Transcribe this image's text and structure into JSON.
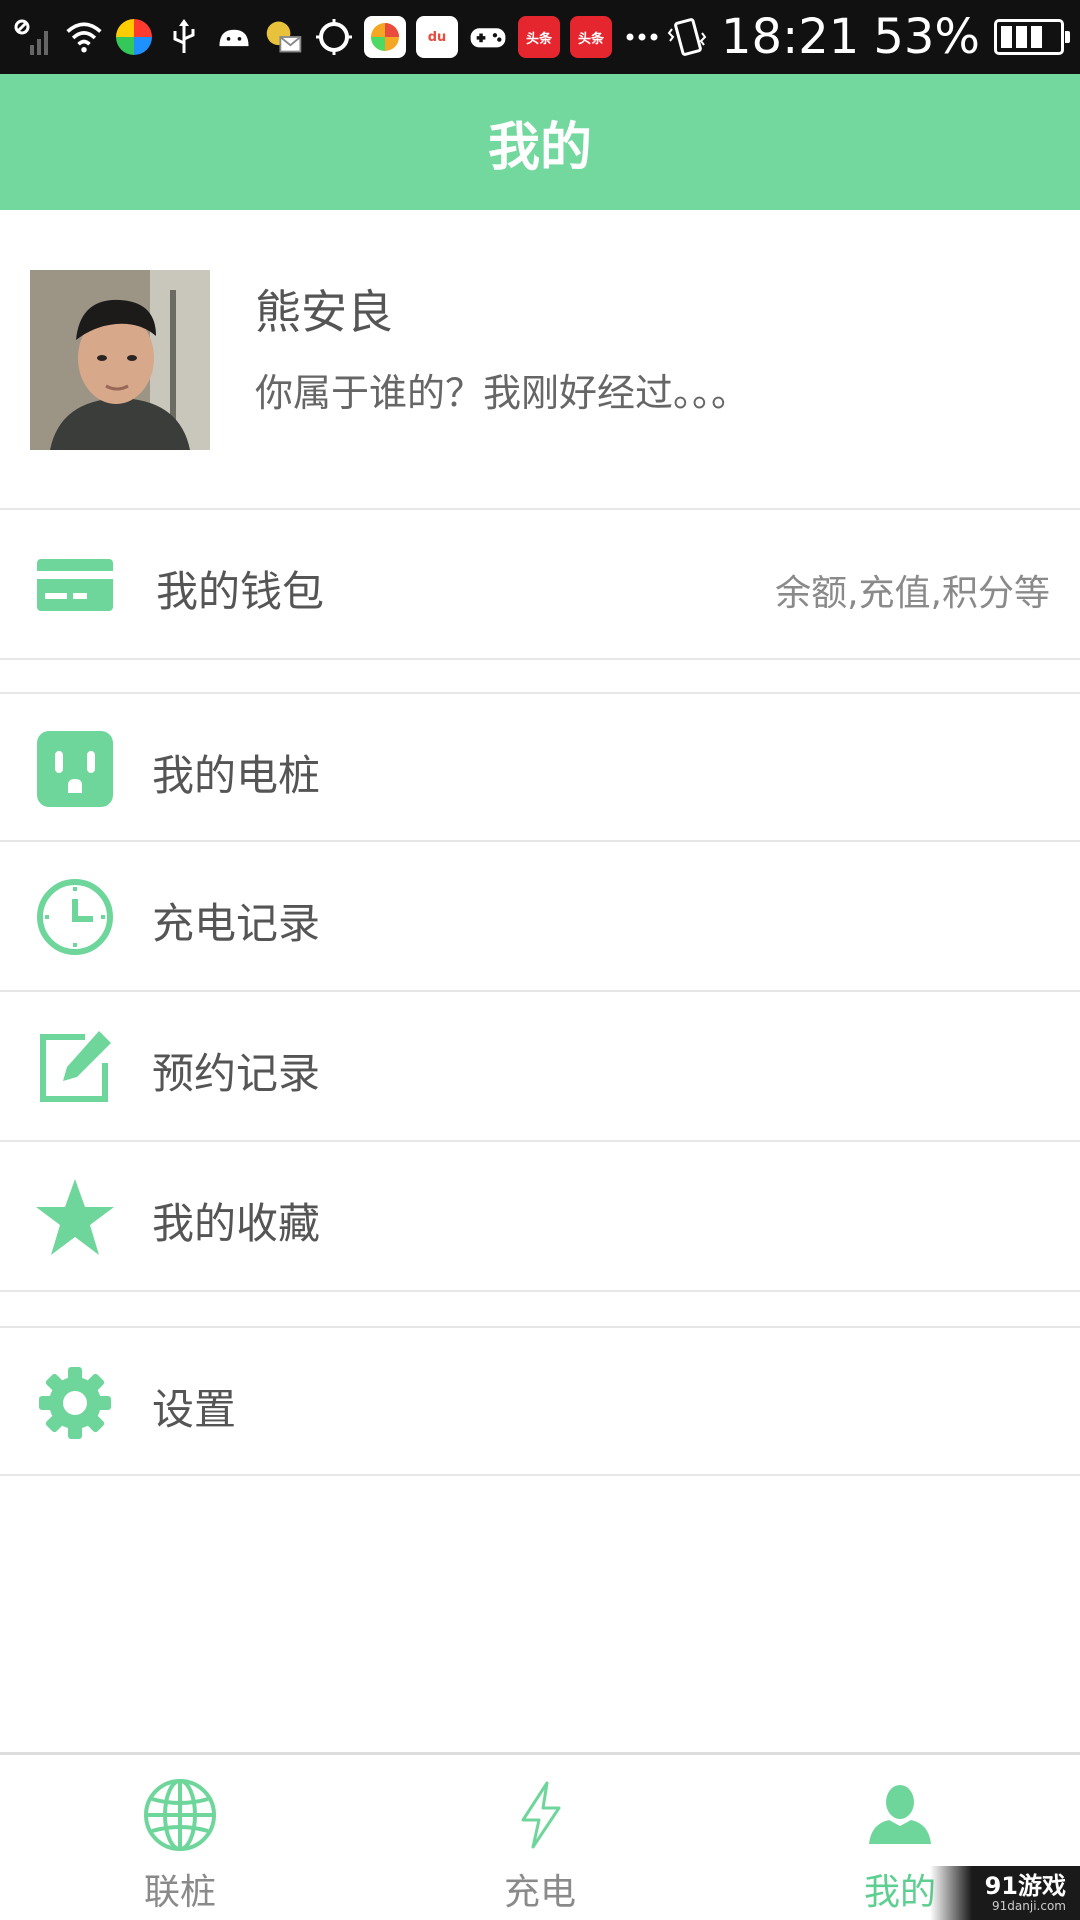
{
  "status_bar": {
    "time": "18:21",
    "battery": "53%",
    "app_badges": [
      "头条",
      "头条"
    ],
    "du_label": "du",
    "icons": [
      "signal-icon",
      "wifi-icon",
      "usb-icon",
      "android-icon",
      "more-icon",
      "vibrate-icon",
      "battery-icon"
    ]
  },
  "header": {
    "title": "我的"
  },
  "profile": {
    "name": "熊安良",
    "signature": "你属于谁的？我刚好经过。。。"
  },
  "menu": {
    "wallet": {
      "label": "我的钱包",
      "sub": "余额,充值,积分等",
      "icon": "wallet-card-icon"
    },
    "piles": {
      "label": "我的电桩",
      "icon": "power-socket-icon"
    },
    "charge_records": {
      "label": "充电记录",
      "icon": "clock-icon"
    },
    "reservation_records": {
      "label": "预约记录",
      "icon": "edit-icon"
    },
    "favorites": {
      "label": "我的收藏",
      "icon": "star-icon"
    },
    "settings": {
      "label": "设置",
      "icon": "gear-icon"
    }
  },
  "tabs": [
    {
      "label": "联桩",
      "icon": "globe-icon",
      "active": false
    },
    {
      "label": "充电",
      "icon": "lightning-icon",
      "active": false
    },
    {
      "label": "我的",
      "icon": "user-icon",
      "active": true
    }
  ],
  "watermark": {
    "main": "91游戏",
    "sub": "91danji.com"
  },
  "colors": {
    "accent": "#72d89e",
    "icon_green": "#6fd69b",
    "text": "#555555",
    "muted": "#8a8a8a"
  }
}
